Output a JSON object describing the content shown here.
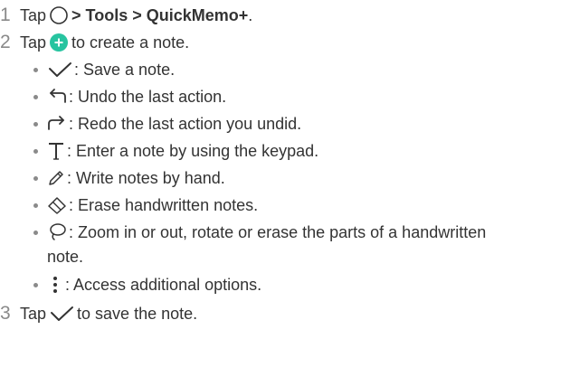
{
  "steps": [
    {
      "number": "1",
      "prefix": "Tap",
      "path": [
        "> Tools > QuickMemo+",
        "."
      ]
    },
    {
      "number": "2",
      "prefix": "Tap",
      "suffix": "to create a note."
    },
    {
      "number": "3",
      "prefix": "Tap",
      "suffix": "to save the note."
    }
  ],
  "bullets": [
    {
      "icon": "checkmark-icon",
      "text": ": Save a note."
    },
    {
      "icon": "undo-icon",
      "text": ": Undo the last action."
    },
    {
      "icon": "redo-icon",
      "text": ": Redo the last action you undid."
    },
    {
      "icon": "text-t-icon",
      "text": ": Enter a note by using the keypad."
    },
    {
      "icon": "pen-icon",
      "text": ": Write notes by hand."
    },
    {
      "icon": "eraser-icon",
      "text": ": Erase handwritten notes."
    },
    {
      "icon": "lasso-icon",
      "text": ": Zoom in or out, rotate or erase the parts of a handwritten",
      "continuation": "note."
    },
    {
      "icon": "more-options-icon",
      "text": ": Access additional options."
    }
  ],
  "colors": {
    "text": "#333333",
    "step_number": "#8a8a8a",
    "add_button": "#27c4a0"
  }
}
